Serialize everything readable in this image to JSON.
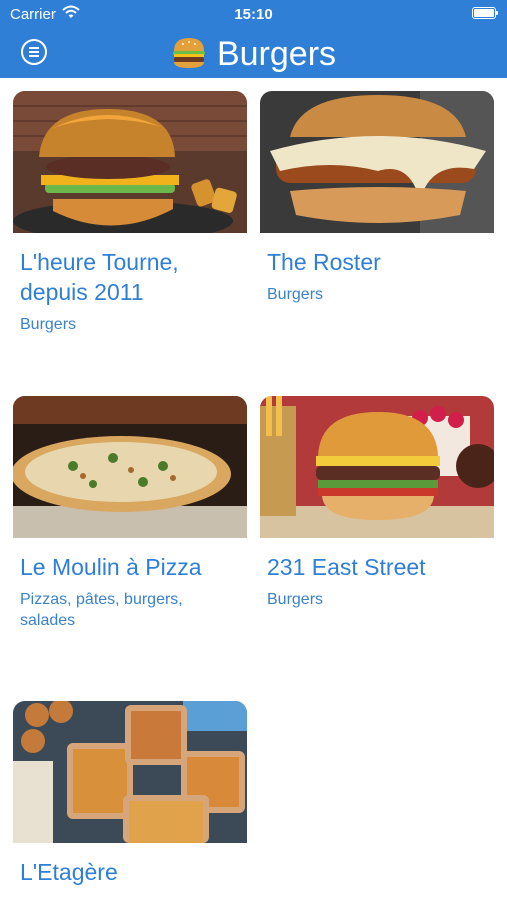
{
  "status_bar": {
    "carrier": "Carrier",
    "time": "15:10"
  },
  "nav": {
    "title": "Burgers"
  },
  "restaurants": [
    {
      "name": "L'heure Tourne, depuis 2011",
      "category": "Burgers"
    },
    {
      "name": "The Roster",
      "category": "Burgers"
    },
    {
      "name": "Le Moulin à Pizza",
      "category": "Pizzas, pâtes, burgers, salades"
    },
    {
      "name": "231 East Street",
      "category": "Burgers"
    },
    {
      "name": "L'Etagère",
      "category": ""
    }
  ],
  "colors": {
    "primary": "#2f7fd6",
    "link": "#2f7fd6",
    "background": "#ffffff"
  },
  "icons": {
    "menu": "menu-circle-icon",
    "title": "burger-emoji-icon",
    "wifi": "wifi-icon",
    "battery": "battery-icon"
  }
}
